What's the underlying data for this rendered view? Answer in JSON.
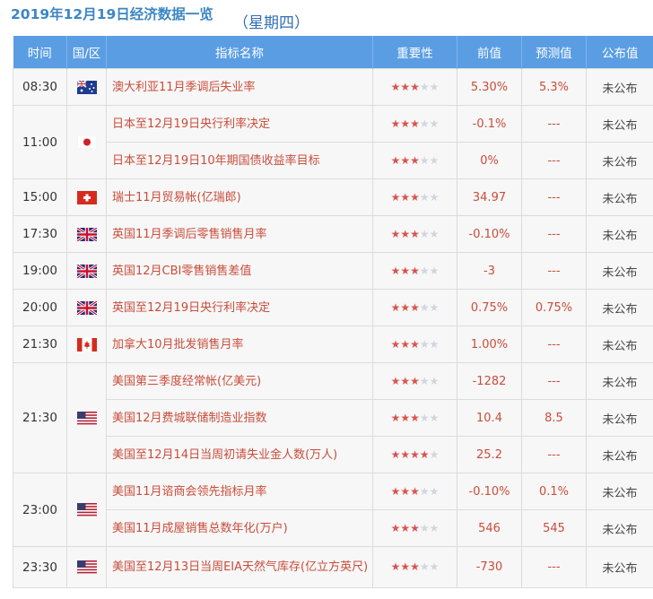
{
  "heading": {
    "date": "2019年12月19日经济数据一览",
    "weekday": "（星期四）"
  },
  "headers": {
    "time": "时间",
    "region": "国/区",
    "indicator": "指标名称",
    "importance": "重要性",
    "previous": "前值",
    "forecast": "预测值",
    "published": "公布值"
  },
  "rows": [
    {
      "time": "08:30",
      "flag": "australia-flag-icon",
      "name": "澳大利亚11月季调后失业率",
      "stars": 3,
      "previous": "5.30%",
      "forecast": "5.3%",
      "published": "未公布"
    },
    {
      "time": "11:00",
      "flag": "japan-flag-icon",
      "name": "日本至12月19日央行利率决定",
      "stars": 3,
      "previous": "-0.1%",
      "forecast": "---",
      "published": "未公布"
    },
    {
      "time": "",
      "flag": "",
      "name": "日本至12月19日10年期国债收益率目标",
      "stars": 3,
      "previous": "0%",
      "forecast": "---",
      "published": "未公布"
    },
    {
      "time": "15:00",
      "flag": "switzerland-flag-icon",
      "name": "瑞士11月贸易帐(亿瑞郎)",
      "stars": 3,
      "previous": "34.97",
      "forecast": "---",
      "published": "未公布"
    },
    {
      "time": "17:30",
      "flag": "uk-flag-icon",
      "name": "英国11月季调后零售销售月率",
      "stars": 3,
      "previous": "-0.10%",
      "forecast": "---",
      "published": "未公布"
    },
    {
      "time": "19:00",
      "flag": "uk-flag-icon",
      "name": "英国12月CBI零售销售差值",
      "stars": 3,
      "previous": "-3",
      "forecast": "---",
      "published": "未公布"
    },
    {
      "time": "20:00",
      "flag": "uk-flag-icon",
      "name": "英国至12月19日央行利率决定",
      "stars": 3,
      "previous": "0.75%",
      "forecast": "0.75%",
      "published": "未公布"
    },
    {
      "time": "21:30",
      "flag": "canada-flag-icon",
      "name": "加拿大10月批发销售月率",
      "stars": 3,
      "previous": "1.00%",
      "forecast": "---",
      "published": "未公布"
    },
    {
      "time": "21:30",
      "flag": "usa-flag-icon",
      "name": "美国第三季度经常帐(亿美元)",
      "stars": 3,
      "previous": "-1282",
      "forecast": "---",
      "published": "未公布"
    },
    {
      "time": "",
      "flag": "",
      "name": "美国12月费城联储制造业指数",
      "stars": 3,
      "previous": "10.4",
      "forecast": "8.5",
      "published": "未公布"
    },
    {
      "time": "",
      "flag": "",
      "name": "美国至12月14日当周初请失业金人数(万人)",
      "stars": 4,
      "previous": "25.2",
      "forecast": "---",
      "published": "未公布"
    },
    {
      "time": "23:00",
      "flag": "usa-flag-icon",
      "name": "美国11月谘商会领先指标月率",
      "stars": 3,
      "previous": "-0.10%",
      "forecast": "0.1%",
      "published": "未公布"
    },
    {
      "time": "",
      "flag": "",
      "name": "美国11月成屋销售总数年化(万户)",
      "stars": 3,
      "previous": "546",
      "forecast": "545",
      "published": "未公布"
    },
    {
      "time": "23:30",
      "flag": "usa-flag-icon",
      "name": "美国至12月13日当周EIA天然气库存(亿立方英尺)",
      "stars": 3,
      "previous": "-730",
      "forecast": "---",
      "published": "未公布"
    }
  ]
}
